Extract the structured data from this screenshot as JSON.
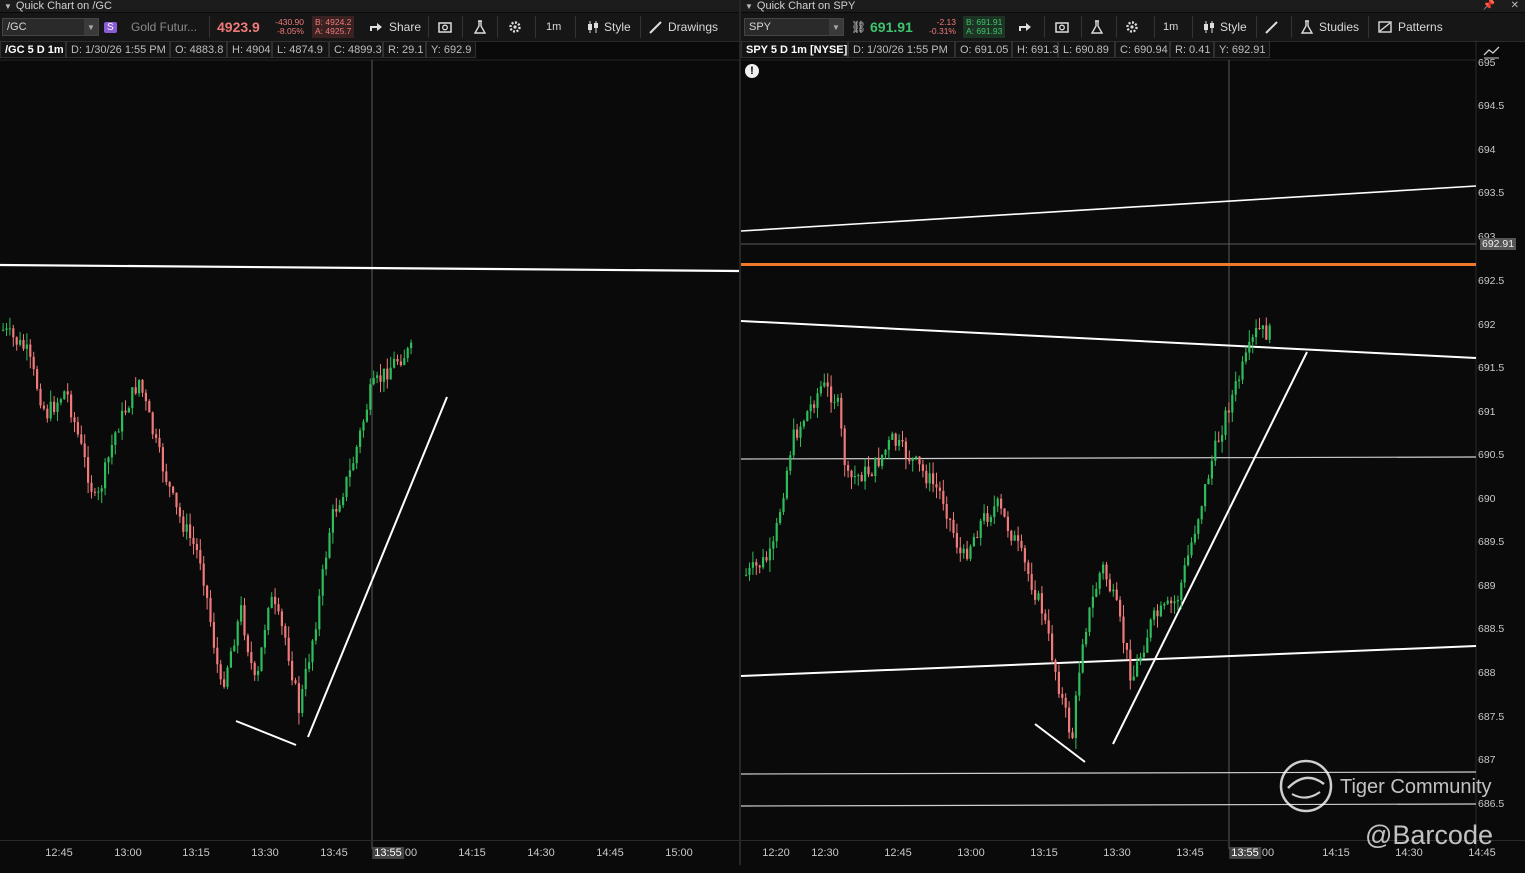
{
  "left": {
    "title": "Quick Chart on /GC",
    "symbol": "/GC",
    "description": "Gold Futur...",
    "badge": "S",
    "price": "4923.9",
    "change": "-430.90",
    "change_pct": "-8.05%",
    "bid": "B: 4924.2",
    "ask": "A: 4925.7",
    "toolbar": {
      "share": "Share",
      "interval": "1m",
      "style": "Style",
      "drawings": "Drawings"
    },
    "info": {
      "label": "/GC 5 D 1m",
      "date": "D: 1/30/26 1:55 PM",
      "open": "O: 4883.8",
      "high": "H: 4904",
      "low": "L: 4874.9",
      "close": "C: 4899.3",
      "range": "R: 29.1",
      "y": "Y: 692.9"
    },
    "time_labels": [
      "12:45",
      "13:00",
      "13:15",
      "13:30",
      "13:45",
      "13:55",
      "00",
      "14:15",
      "14:30",
      "14:45",
      "15:00"
    ],
    "cursor_time": "13:55",
    "colors": {
      "up": "#2ebd5a",
      "down": "#f07a7a",
      "line": "#ffffff"
    }
  },
  "right": {
    "title": "Quick Chart on SPY",
    "symbol": "SPY",
    "price": "691.91",
    "change": "-2.13",
    "change_pct": "-0.31%",
    "bid": "B: 691.91",
    "ask": "A: 691.93",
    "toolbar": {
      "interval": "1m",
      "style": "Style",
      "studies": "Studies",
      "patterns": "Patterns"
    },
    "info": {
      "label": "SPY 5 D 1m [NYSE]",
      "date": "D: 1/30/26 1:55 PM",
      "open": "O: 691.05",
      "high": "H: 691.3",
      "low": "L: 690.89",
      "close": "C: 690.94",
      "range": "R: 0.41",
      "y": "Y: 692.91"
    },
    "alert_icon": "!",
    "price_labels": [
      "695",
      "694.5",
      "694",
      "693.5",
      "693",
      "692.5",
      "692",
      "691.5",
      "691",
      "690.5",
      "690",
      "689.5",
      "689",
      "688.5",
      "688",
      "687.5",
      "687",
      "686.5"
    ],
    "cursor_price": "692.91",
    "time_labels": [
      "12:20",
      "12:30",
      "12:45",
      "13:00",
      "13:15",
      "13:30",
      "13:45",
      "13:55",
      "00",
      "14:15",
      "14:30",
      "14:45"
    ],
    "cursor_time": "13:55",
    "colors": {
      "up": "#2ebd5a",
      "down": "#f07a7a",
      "resistance": "#f2782a",
      "line": "#ffffff"
    }
  },
  "watermark": {
    "brand": "Tiger Community",
    "handle": "@Barcode"
  }
}
